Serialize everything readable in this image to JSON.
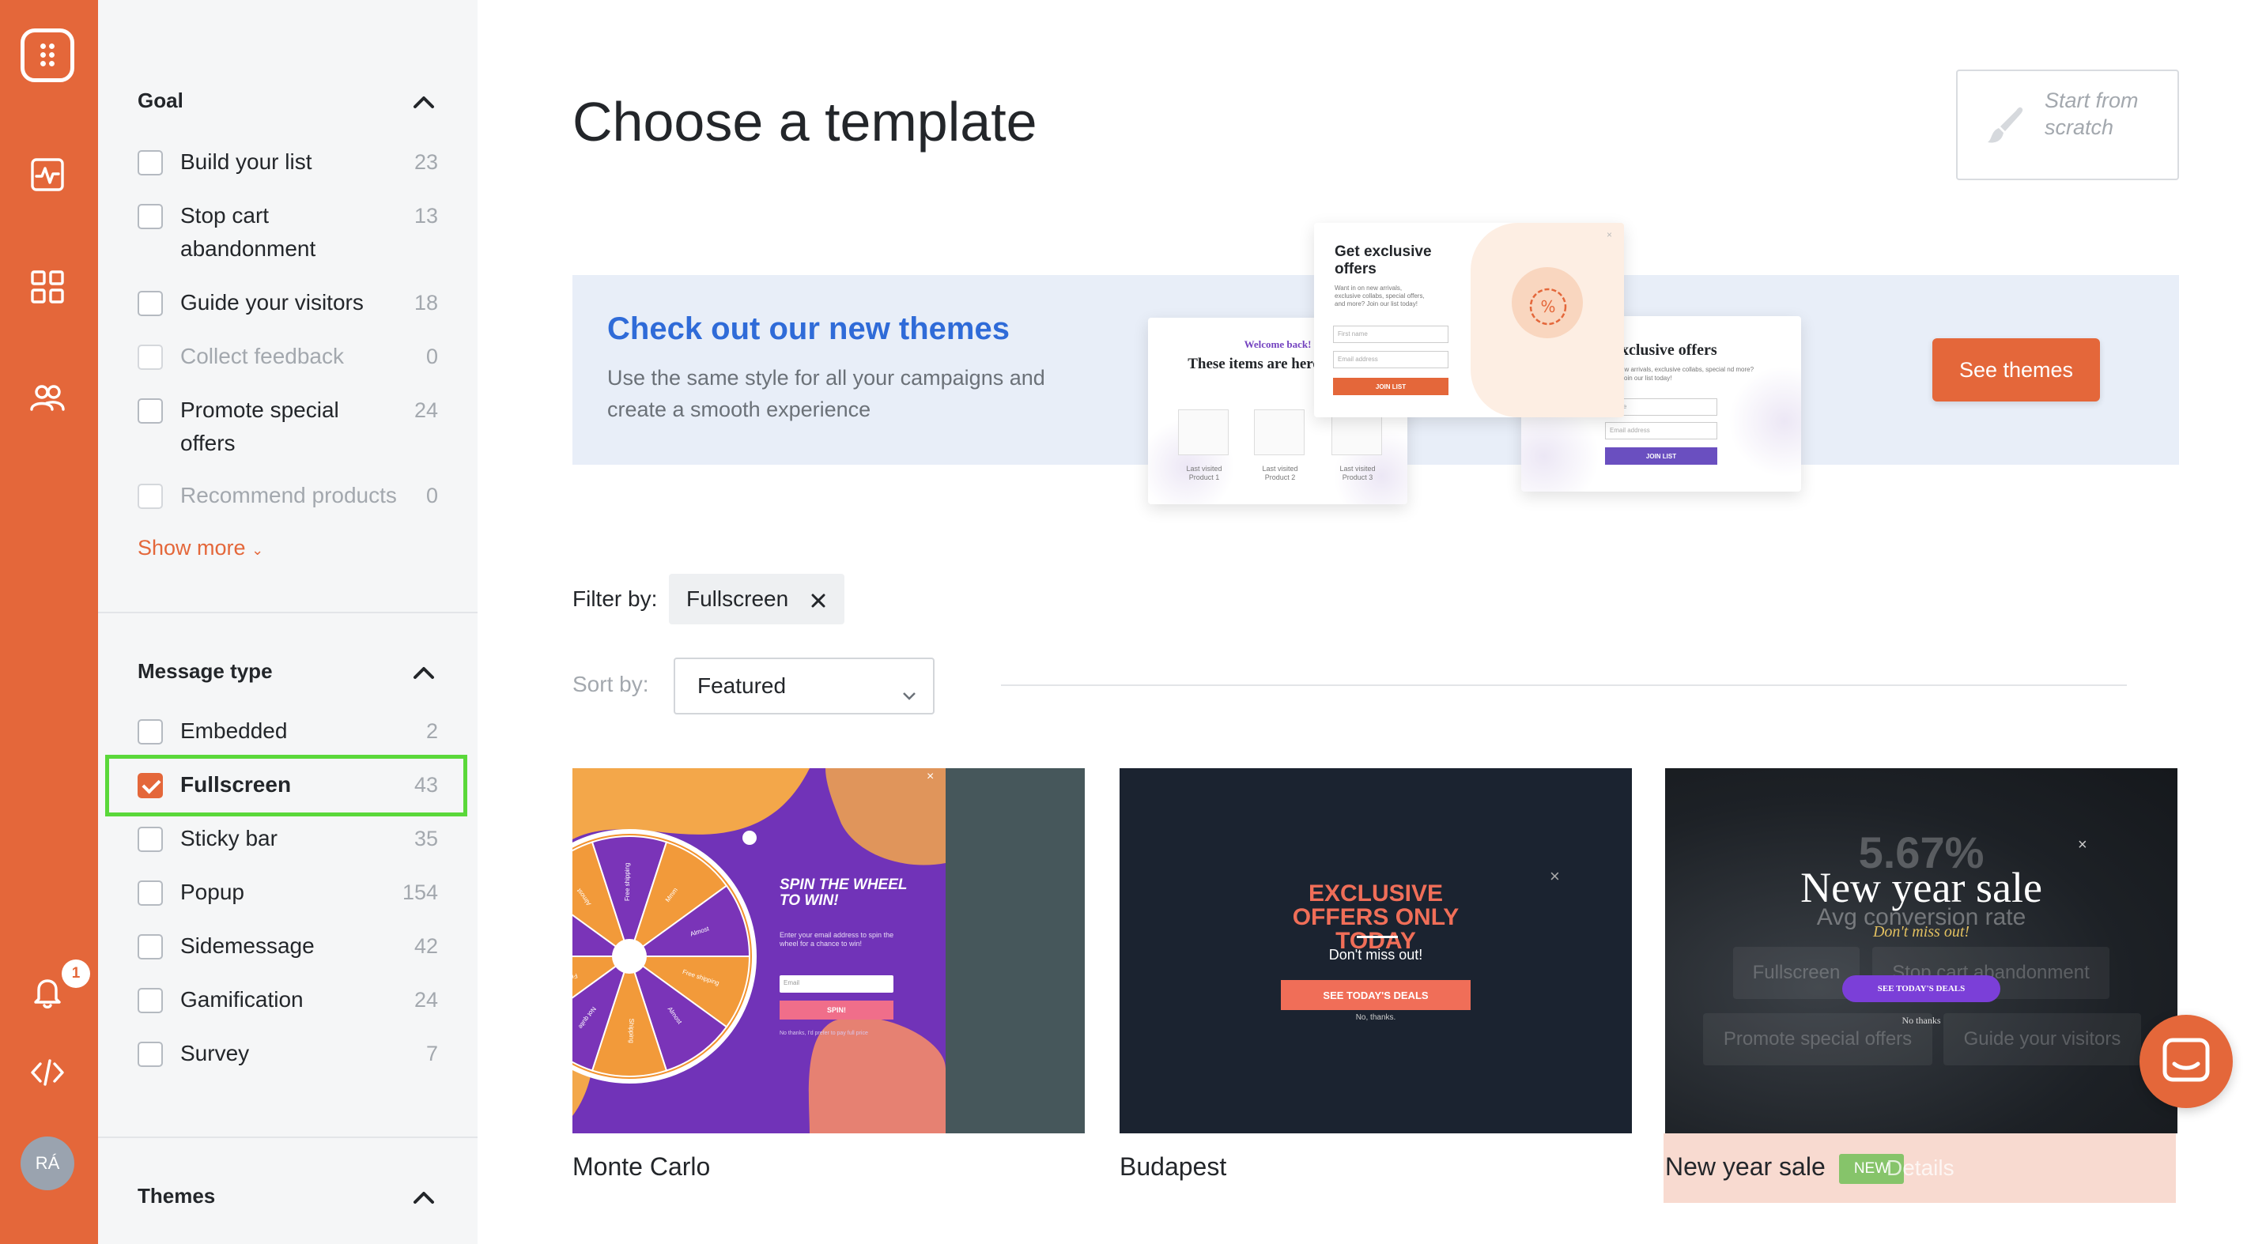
{
  "rail": {
    "icons": [
      "app-logo-icon",
      "analytics-icon",
      "campaigns-grid-icon",
      "subscribers-icon",
      "notifications-bell-icon",
      "code-icon"
    ],
    "notification_count": "1",
    "avatar_initials": "RÁ"
  },
  "sidebar": {
    "goal": {
      "title": "Goal",
      "options": [
        {
          "label": "Build your list",
          "count": "23",
          "checked": false,
          "disabled": false
        },
        {
          "label": "Stop cart abandonment",
          "count": "13",
          "checked": false,
          "disabled": false
        },
        {
          "label": "Guide your visitors",
          "count": "18",
          "checked": false,
          "disabled": false
        },
        {
          "label": "Collect feedback",
          "count": "0",
          "checked": false,
          "disabled": true
        },
        {
          "label": "Promote special offers",
          "count": "24",
          "checked": false,
          "disabled": false
        },
        {
          "label": "Recommend products",
          "count": "0",
          "checked": false,
          "disabled": true
        }
      ],
      "show_more": "Show more"
    },
    "message_type": {
      "title": "Message type",
      "options": [
        {
          "label": "Embedded",
          "count": "2",
          "checked": false
        },
        {
          "label": "Fullscreen",
          "count": "43",
          "checked": true
        },
        {
          "label": "Sticky bar",
          "count": "35",
          "checked": false
        },
        {
          "label": "Popup",
          "count": "154",
          "checked": false
        },
        {
          "label": "Sidemessage",
          "count": "42",
          "checked": false
        },
        {
          "label": "Gamification",
          "count": "24",
          "checked": false
        },
        {
          "label": "Survey",
          "count": "7",
          "checked": false
        }
      ]
    },
    "themes": {
      "title": "Themes"
    }
  },
  "main": {
    "title": "Choose a template",
    "start_from_scratch": "Start from scratch",
    "banner": {
      "heading": "Check out our new themes",
      "text": "Use the same style for all your campaigns and create a smooth experience",
      "button": "See themes",
      "preview_left": {
        "welcome": "Welcome back!",
        "title": "These items are here for you",
        "products": [
          "Last visited Product 1",
          "Last visited Product 2",
          "Last visited Product 3"
        ]
      },
      "preview_center": {
        "title": "Get exclusive offers",
        "text": "Want in on new arrivals, exclusive collabs, special offers, and more? Join our list today!",
        "field1": "First name",
        "field2": "Email address",
        "button": "JOIN LIST"
      },
      "preview_right": {
        "title": "xclusive offers",
        "text": "ew arrivals, exclusive collabs, special nd more? Join our list today!",
        "field1": "Name",
        "field2": "Email address",
        "button": "JOIN LIST"
      }
    },
    "filter": {
      "label": "Filter by:",
      "chip": "Fullscreen"
    },
    "sort": {
      "label": "Sort by:",
      "value": "Featured"
    },
    "templates": [
      {
        "name": "Monte Carlo",
        "preview": {
          "heading": "SPIN THE WHEEL TO WIN!",
          "text": "Enter your email address to spin the wheel for a chance to win!",
          "field": "Email",
          "button": "SPIN!",
          "no_thanks": "No thanks, I'd prefer to pay full price",
          "wheel_labels": [
            "Free shipping",
            "Almost",
            "Shipping",
            "Not quite",
            "Free shipping",
            "So close",
            "Almost",
            "Free shipping",
            "Mmm",
            "Almost"
          ]
        }
      },
      {
        "name": "Budapest",
        "preview": {
          "heading": "EXCLUSIVE OFFERS ONLY TODAY",
          "text": "Don't miss out!",
          "button": "SEE TODAY'S DEALS",
          "no_thanks": "No, thanks."
        }
      },
      {
        "name": "New year sale",
        "badge": "NEW",
        "details": "Details",
        "preview": {
          "conversion": "5.67%",
          "heading": "New year sale",
          "avg": "Avg conversion rate",
          "tagline": "Don't miss out!",
          "button": "SEE TODAY'S DEALS",
          "no_thanks": "No thanks",
          "tags": [
            "Fullscreen",
            "Stop cart abandonment",
            "Promote special offers",
            "Guide your visitors"
          ]
        }
      }
    ]
  },
  "colors": {
    "brand": "#e4673a",
    "link_blue": "#2f6bd8",
    "highlight_green": "#5ad83a",
    "new_badge": "#86c46a"
  }
}
